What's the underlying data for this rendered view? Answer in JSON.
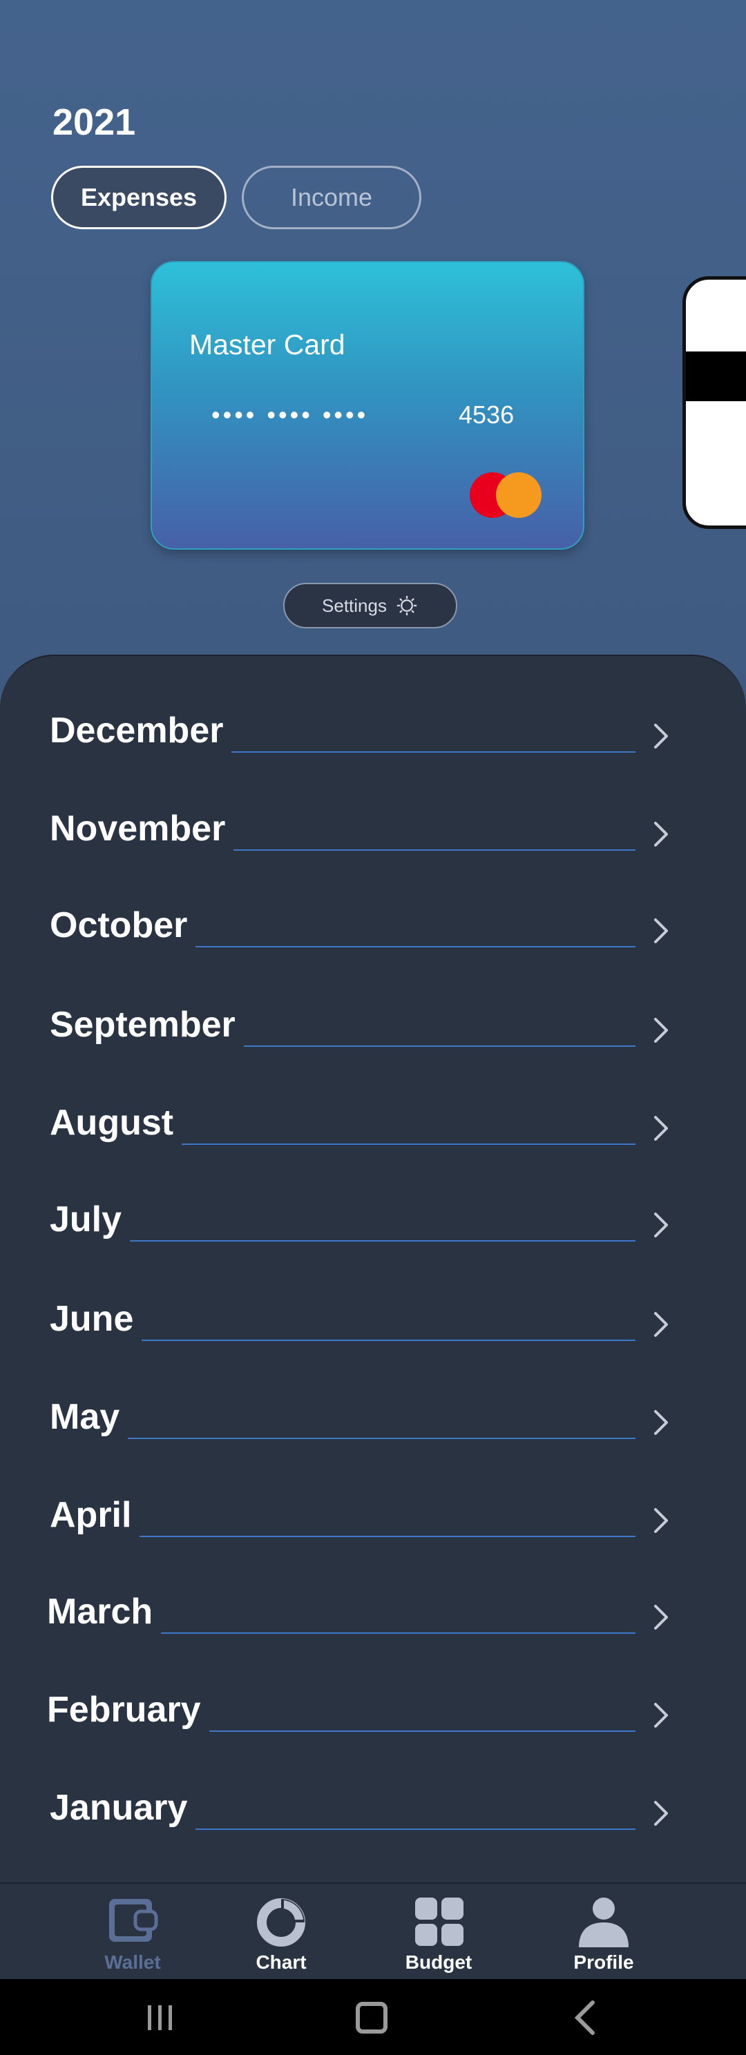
{
  "header": {
    "year": "2021"
  },
  "tabs": {
    "expenses": "Expenses",
    "income": "Income"
  },
  "card": {
    "name": "Master Card",
    "masked": "•••• •••• ••••",
    "last4": "4536",
    "brand_icon": "mastercard-logo",
    "gradient_top": "#2ec0d8",
    "gradient_bottom": "#4760a8"
  },
  "settings": {
    "label": "Settings",
    "icon": "gear-icon"
  },
  "months": [
    "December",
    "November",
    "October",
    "September",
    "August",
    "July",
    "June",
    "May",
    "April",
    "March",
    "February",
    "January"
  ],
  "nav": [
    {
      "label": "Wallet",
      "icon": "wallet-icon",
      "active": true
    },
    {
      "label": "Chart",
      "icon": "chart-icon",
      "active": false
    },
    {
      "label": "Budget",
      "icon": "budget-icon",
      "active": false
    },
    {
      "label": "Profile",
      "icon": "profile-icon",
      "active": false
    }
  ],
  "colors": {
    "panel": "#2a3342",
    "accent_line": "#3d78c8",
    "active_nav": "#5b6e96",
    "inactive_nav": "#b9c1d0"
  }
}
